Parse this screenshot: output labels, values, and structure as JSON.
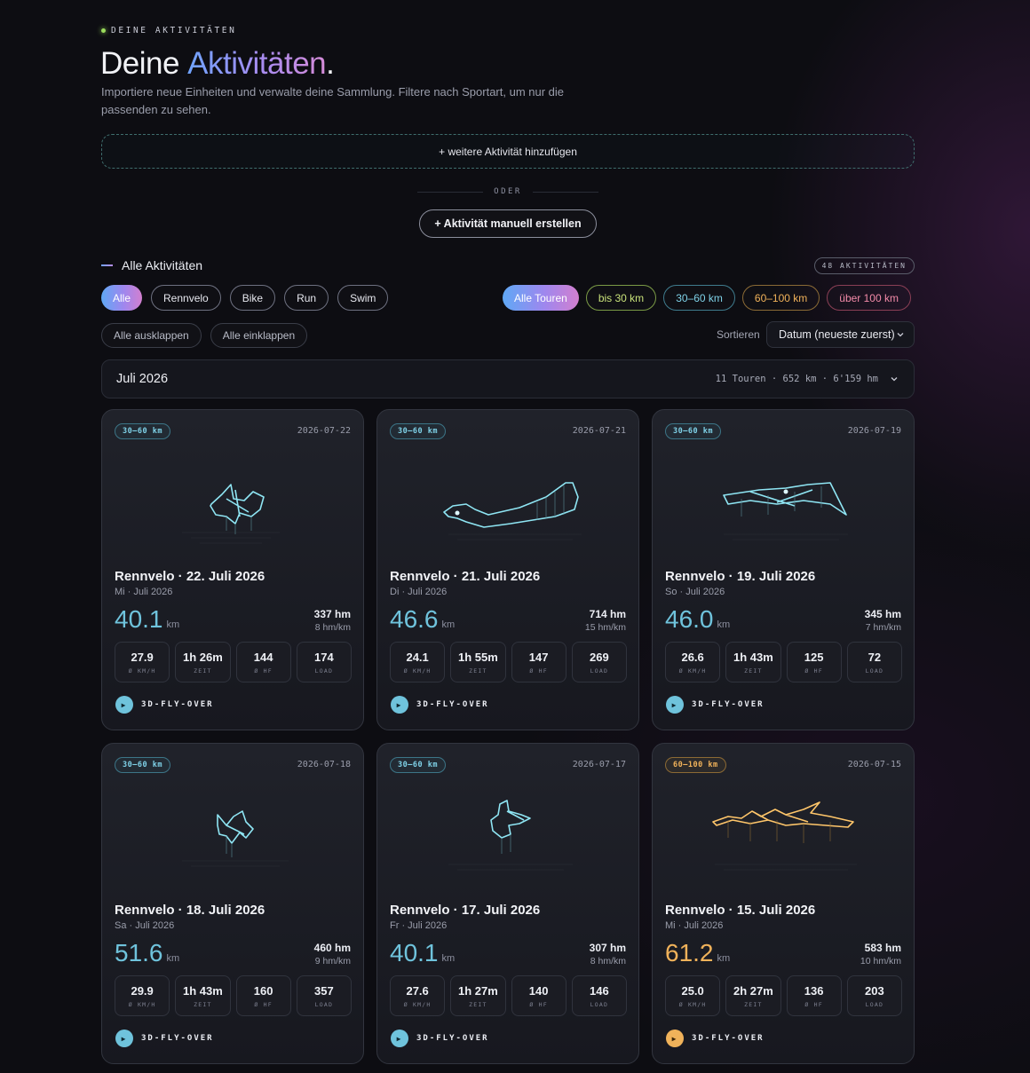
{
  "header": {
    "kicker": "DEINE AKTIVITÄTEN",
    "title_plain": "Deine ",
    "title_accent": "Aktivitäten",
    "title_dot": ".",
    "subtitle": "Importiere neue Einheiten und verwalte deine Sammlung. Filtere nach Sportart, um nur die passenden zu sehen."
  },
  "dropzone_label": "+ weitere Aktivität hinzufügen",
  "divider_label": "ODER",
  "manual_button": "+ Aktivität manuell erstellen",
  "section": {
    "title": "Alle Aktivitäten",
    "count": "48 AKTIVITÄTEN"
  },
  "sport_filters": [
    "Alle",
    "Rennvelo",
    "Bike",
    "Run",
    "Swim"
  ],
  "distance_filters": [
    "Alle Touren",
    "bis 30 km",
    "30–60 km",
    "60–100 km",
    "über 100 km"
  ],
  "expand_label": "Alle ausklappen",
  "collapse_label": "Alle einklappen",
  "sort": {
    "label": "Sortieren",
    "value": "Datum (neueste zuerst)"
  },
  "month": {
    "title": "Juli 2026",
    "summary": "11 Touren · 652 km · 6'159 hm"
  },
  "stat_labels": {
    "speed": "Ø KM/H",
    "time": "ZEIT",
    "hr": "Ø HF",
    "load": "LOAD"
  },
  "flyover_label": "3D-FLY-OVER",
  "unit_km": "km",
  "colors": {
    "accent_cyan": "#6fc3dc",
    "accent_orange": "#f0b25a",
    "background": "#0d0d12"
  },
  "activities": [
    {
      "tag": "30–60 km",
      "date": "2026-07-22",
      "title": "Rennvelo · 22. Juli 2026",
      "sub": "Mi · Juli 2026",
      "distance": "40.1",
      "elevation": "337 hm",
      "rate": "8 hm/km",
      "speed": "27.9",
      "time": "1h 26m",
      "hr": "144",
      "load": "174"
    },
    {
      "tag": "30–60 km",
      "date": "2026-07-21",
      "title": "Rennvelo · 21. Juli 2026",
      "sub": "Di · Juli 2026",
      "distance": "46.6",
      "elevation": "714 hm",
      "rate": "15 hm/km",
      "speed": "24.1",
      "time": "1h 55m",
      "hr": "147",
      "load": "269"
    },
    {
      "tag": "30–60 km",
      "date": "2026-07-19",
      "title": "Rennvelo · 19. Juli 2026",
      "sub": "So · Juli 2026",
      "distance": "46.0",
      "elevation": "345 hm",
      "rate": "7 hm/km",
      "speed": "26.6",
      "time": "1h 43m",
      "hr": "125",
      "load": "72"
    },
    {
      "tag": "30–60 km",
      "date": "2026-07-18",
      "title": "Rennvelo · 18. Juli 2026",
      "sub": "Sa · Juli 2026",
      "distance": "51.6",
      "elevation": "460 hm",
      "rate": "9 hm/km",
      "speed": "29.9",
      "time": "1h 43m",
      "hr": "160",
      "load": "357"
    },
    {
      "tag": "30–60 km",
      "date": "2026-07-17",
      "title": "Rennvelo · 17. Juli 2026",
      "sub": "Fr · Juli 2026",
      "distance": "40.1",
      "elevation": "307 hm",
      "rate": "8 hm/km",
      "speed": "27.6",
      "time": "1h 27m",
      "hr": "140",
      "load": "146"
    },
    {
      "tag": "60–100 km",
      "date": "2026-07-15",
      "title": "Rennvelo · 15. Juli 2026",
      "sub": "Mi · Juli 2026",
      "distance": "61.2",
      "elevation": "583 hm",
      "rate": "10 hm/km",
      "speed": "25.0",
      "time": "2h 27m",
      "hr": "136",
      "load": "203"
    }
  ]
}
